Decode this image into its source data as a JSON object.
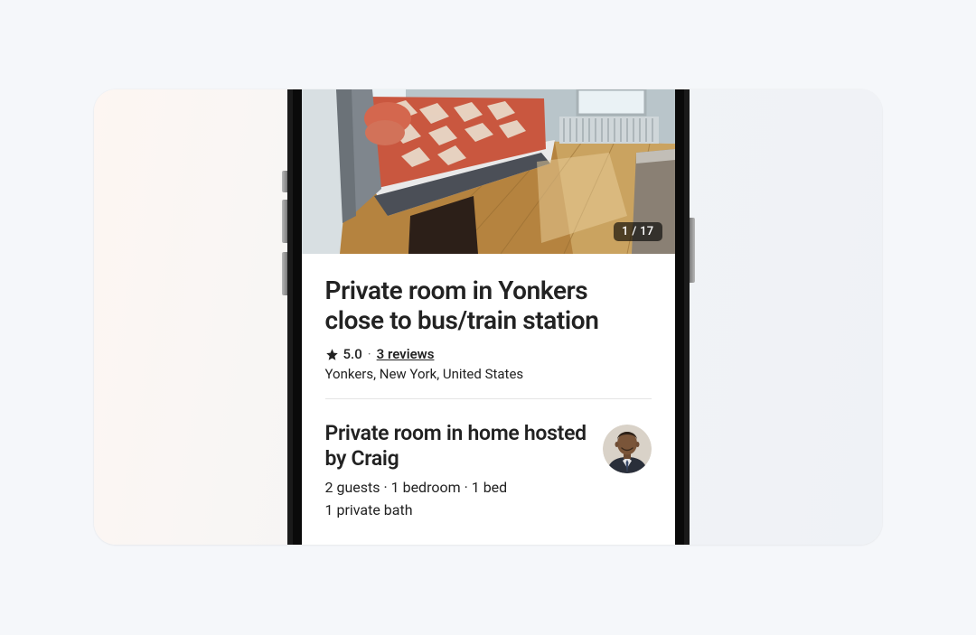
{
  "hero": {
    "photo_counter": "1 / 17"
  },
  "listing": {
    "title": "Private room in Yonkers close to bus/train station",
    "rating": "5.0",
    "reviews_label": "3 reviews",
    "location": "Yonkers, New York, United States"
  },
  "host": {
    "heading": "Private room in home hosted by Craig",
    "specs_line1": "2 guests · 1 bedroom · 1 bed",
    "specs_line2": "1 private bath"
  }
}
